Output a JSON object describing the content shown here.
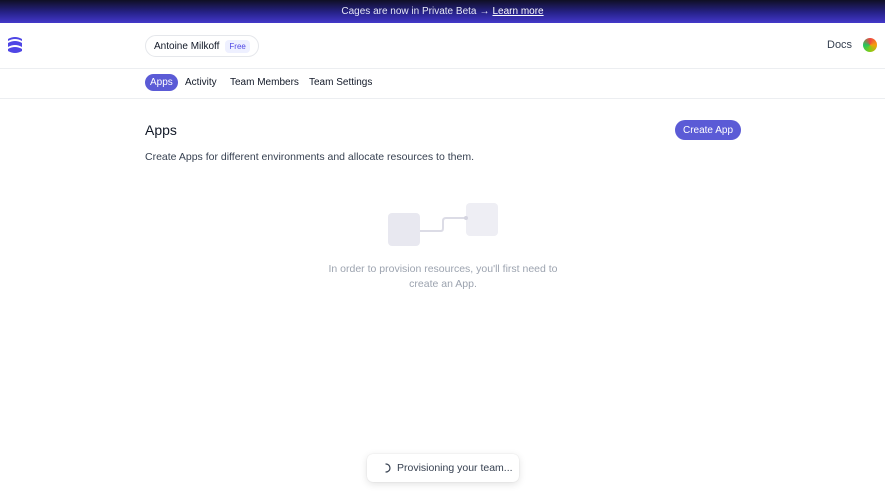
{
  "banner": {
    "text": "Cages are now in Private Beta",
    "arrow": "→",
    "link": "Learn more"
  },
  "header": {
    "logo_icon": "evervault-logo-icon",
    "team_name": "Antoine Milkoff",
    "plan_badge": "Free",
    "docs_label": "Docs",
    "avatar_icon": "user-avatar"
  },
  "tabs": [
    {
      "label": "Apps",
      "active": true
    },
    {
      "label": "Activity",
      "active": false
    },
    {
      "label": "Team Members",
      "active": false
    },
    {
      "label": "Team Settings",
      "active": false
    }
  ],
  "main": {
    "title": "Apps",
    "create_button": "Create App",
    "description": "Create Apps for different environments and allocate resources to them.",
    "empty_state": {
      "illustration_icon": "connected-boxes-icon",
      "line1": "In order to provision resources, you'll first need to",
      "line2": "create an App."
    }
  },
  "toast": {
    "spinner_icon": "spinner-icon",
    "text": "Provisioning your team..."
  },
  "colors": {
    "accent": "#5b5bd6",
    "banner_start": "#0f0f24",
    "banner_end": "#4338ca",
    "muted_text": "#9ca3af"
  }
}
